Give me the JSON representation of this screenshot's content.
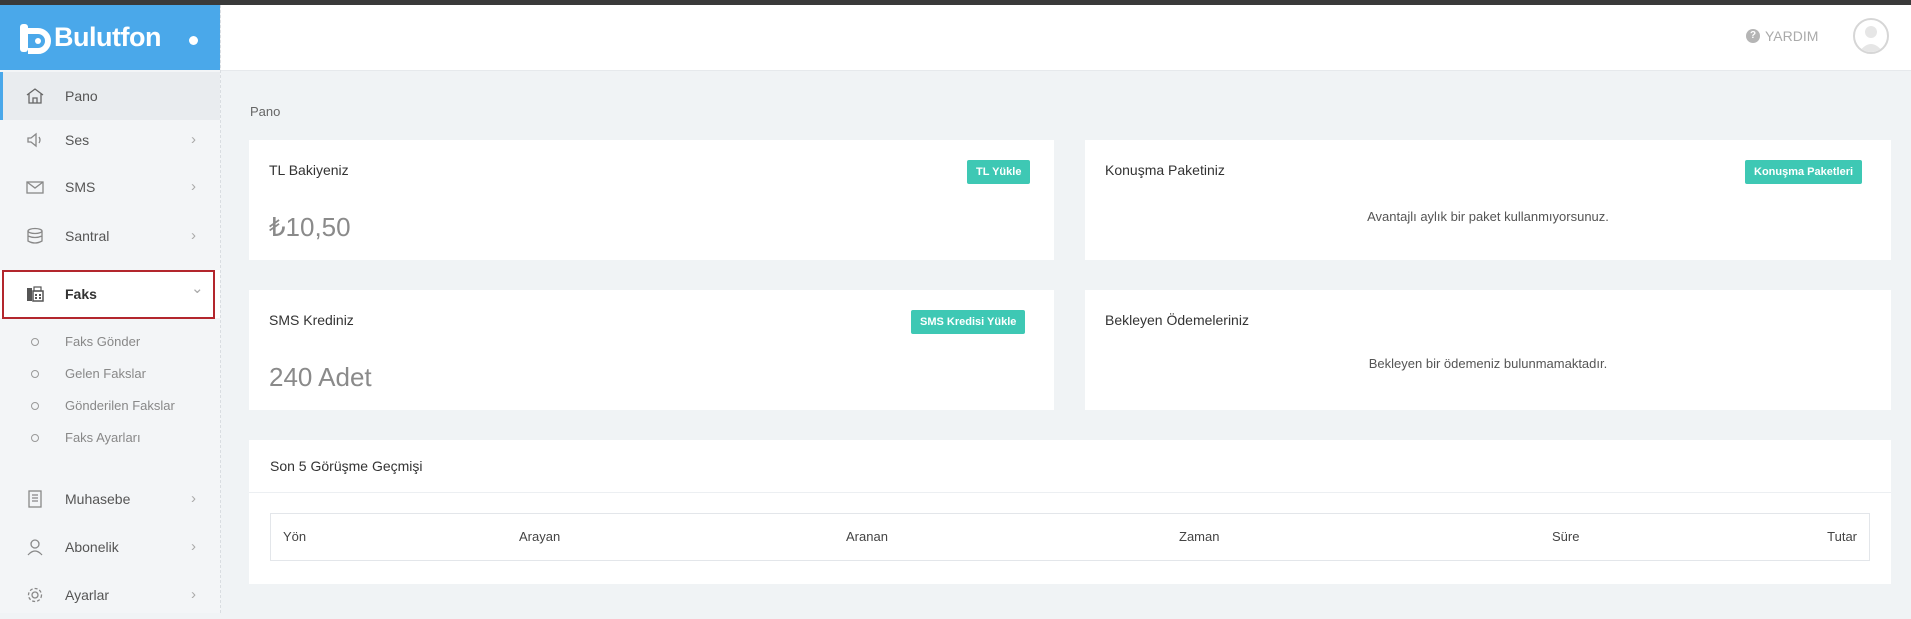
{
  "app": {
    "logo_text": "Bulutfon"
  },
  "sidebar": {
    "items": [
      {
        "label": "Pano",
        "icon": "home-icon"
      },
      {
        "label": "Ses",
        "icon": "speaker-icon"
      },
      {
        "label": "SMS",
        "icon": "envelope-icon"
      },
      {
        "label": "Santral",
        "icon": "database-icon"
      },
      {
        "label": "Faks",
        "icon": "fax-icon"
      },
      {
        "label": "Muhasebe",
        "icon": "document-icon"
      },
      {
        "label": "Abonelik",
        "icon": "user-icon"
      },
      {
        "label": "Ayarlar",
        "icon": "gear-icon"
      }
    ],
    "faks_submenu": [
      "Faks Gönder",
      "Gelen Fakslar",
      "Gönderilen Fakslar",
      "Faks Ayarları"
    ],
    "chevron_right": "›",
    "chevron_down": "⌄"
  },
  "header": {
    "help_label": "YARDIM",
    "help_icon": "?"
  },
  "breadcrumb": "Pano",
  "cards": {
    "balance": {
      "title": "TL Bakiyeniz",
      "button": "TL Yükle",
      "value": "₺10,50"
    },
    "package": {
      "title": "Konuşma Paketiniz",
      "button": "Konuşma Paketleri",
      "message": "Avantajlı aylık bir paket kullanmıyorsunuz."
    },
    "sms": {
      "title": "SMS Krediniz",
      "button": "SMS Kredisi Yükle",
      "value": "240 Adet"
    },
    "payments": {
      "title": "Bekleyen Ödemeleriniz",
      "message": "Bekleyen bir ödemeniz bulunmamaktadır."
    }
  },
  "history": {
    "title": "Son 5 Görüşme Geçmişi",
    "columns": [
      "Yön",
      "Arayan",
      "Aranan",
      "Zaman",
      "Süre",
      "Tutar"
    ]
  },
  "colors": {
    "brand": "#4aa8ea",
    "accent_button": "#3ec8b4",
    "highlight_border": "#b3262d"
  }
}
